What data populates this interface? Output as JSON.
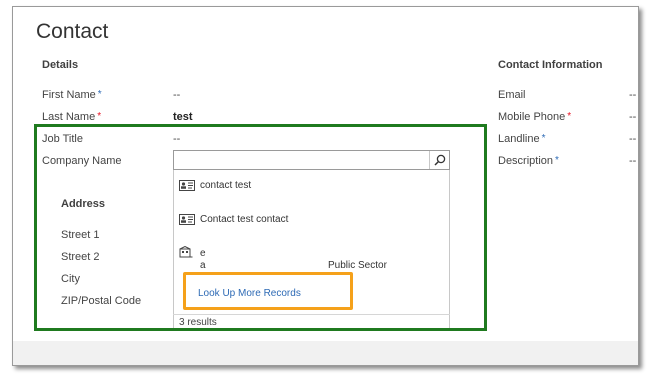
{
  "page": {
    "title": "Contact"
  },
  "details": {
    "heading": "Details",
    "first_name": {
      "label": "First Name",
      "marker": "*",
      "value": "--"
    },
    "last_name": {
      "label": "Last Name",
      "marker": "*",
      "value": "test"
    },
    "job_title": {
      "label": "Job Title",
      "value": "--"
    },
    "company_name": {
      "label": "Company Name",
      "value": ""
    }
  },
  "address": {
    "heading": "Address",
    "street1": "Street 1",
    "street2": "Street 2",
    "city": "City",
    "zip": "ZIP/Postal Code"
  },
  "contact_info": {
    "heading": "Contact Information",
    "email": {
      "label": "Email",
      "value": "--"
    },
    "mobile_phone": {
      "label": "Mobile Phone",
      "marker": "*",
      "value": "--"
    },
    "landline": {
      "label": "Landline",
      "marker": "*",
      "value": "--"
    },
    "description": {
      "label": "Description",
      "marker": "*",
      "value": "--"
    }
  },
  "lookup": {
    "results": [
      {
        "name": "contact test",
        "icon": "contact-card-icon"
      },
      {
        "name": "Contact test contact",
        "icon": "contact-card-icon"
      },
      {
        "name": "e",
        "sub": "a",
        "extra": "Public Sector",
        "icon": "account-icon"
      }
    ],
    "look_up_more": "Look Up More Records",
    "count": "3 results"
  },
  "colors": {
    "highlight_green": "#1f7a1f",
    "highlight_orange": "#f5a11a",
    "link_blue": "#2d6ab5",
    "required_red": "#e81123"
  }
}
